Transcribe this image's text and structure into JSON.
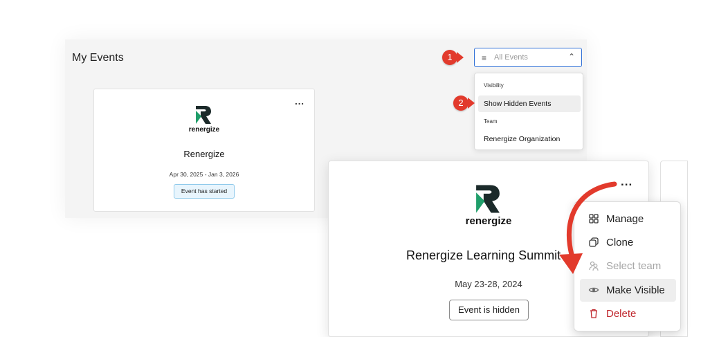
{
  "page": {
    "title": "My Events"
  },
  "filter": {
    "icon": "filter-lines-icon",
    "value": "All Events",
    "chevron": "chevron-up-icon"
  },
  "dropdown": {
    "visibility_header": "Visibility",
    "show_hidden": "Show Hidden Events",
    "team_header": "Team",
    "team_option": "Renergize Organization"
  },
  "callouts": {
    "step1": "1",
    "step2": "2",
    "color": "#e23a2c"
  },
  "small_card": {
    "logo_text": "renergize",
    "title": "Renergize",
    "dates": "Apr 30, 2025 - Jan 3, 2026",
    "status": "Event has started",
    "more": "..."
  },
  "large_card": {
    "logo_text": "renergize",
    "title": "Renergize Learning Summit",
    "dates": "May 23-28, 2024",
    "status": "Event is hidden",
    "more": "..."
  },
  "context_menu": {
    "items": [
      {
        "label": "Manage",
        "icon": "grid-icon",
        "state": "enabled"
      },
      {
        "label": "Clone",
        "icon": "copy-icon",
        "state": "enabled"
      },
      {
        "label": "Select team",
        "icon": "team-icon",
        "state": "disabled"
      },
      {
        "label": "Make Visible",
        "icon": "eye-icon",
        "state": "highlighted"
      },
      {
        "label": "Delete",
        "icon": "trash-icon",
        "state": "danger"
      }
    ]
  },
  "colors": {
    "accent_blue": "#2f6fd6",
    "danger_red": "#c0272d",
    "logo_green": "#1f9e6a",
    "logo_dark": "#1b2a2a"
  }
}
